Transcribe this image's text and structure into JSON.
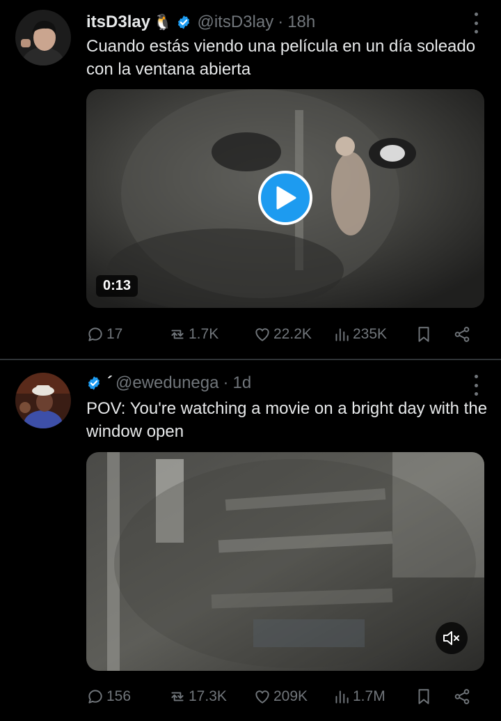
{
  "tweets": [
    {
      "display_name": "itsD3lay",
      "name_emoji": "🐧",
      "handle": "@itsD3lay",
      "separator": "·",
      "time": "18h",
      "text": "Cuando estás viendo una película en un día soleado con la ventana abierta",
      "media": {
        "type": "video",
        "duration": "0:13",
        "controls": [
          "play-icon"
        ]
      },
      "stats": {
        "replies": "17",
        "retweets": "1.7K",
        "likes": "22.2K",
        "views": "235K"
      },
      "verified_color": "#1d9bf0"
    },
    {
      "display_name": "´",
      "handle": "@ewedunega",
      "separator": "·",
      "time": "1d",
      "text": "POV: You're watching a movie on a bright day with the window open",
      "media": {
        "type": "video",
        "controls": [
          "mute-icon"
        ]
      },
      "stats": {
        "replies": "156",
        "retweets": "17.3K",
        "likes": "209K",
        "views": "1.7M"
      },
      "verified_color": "#1d9bf0"
    }
  ],
  "colors": {
    "background": "#000000",
    "text": "#e7e9ea",
    "secondary": "#71767b",
    "accent": "#1d9bf0",
    "divider": "#2f3336"
  }
}
